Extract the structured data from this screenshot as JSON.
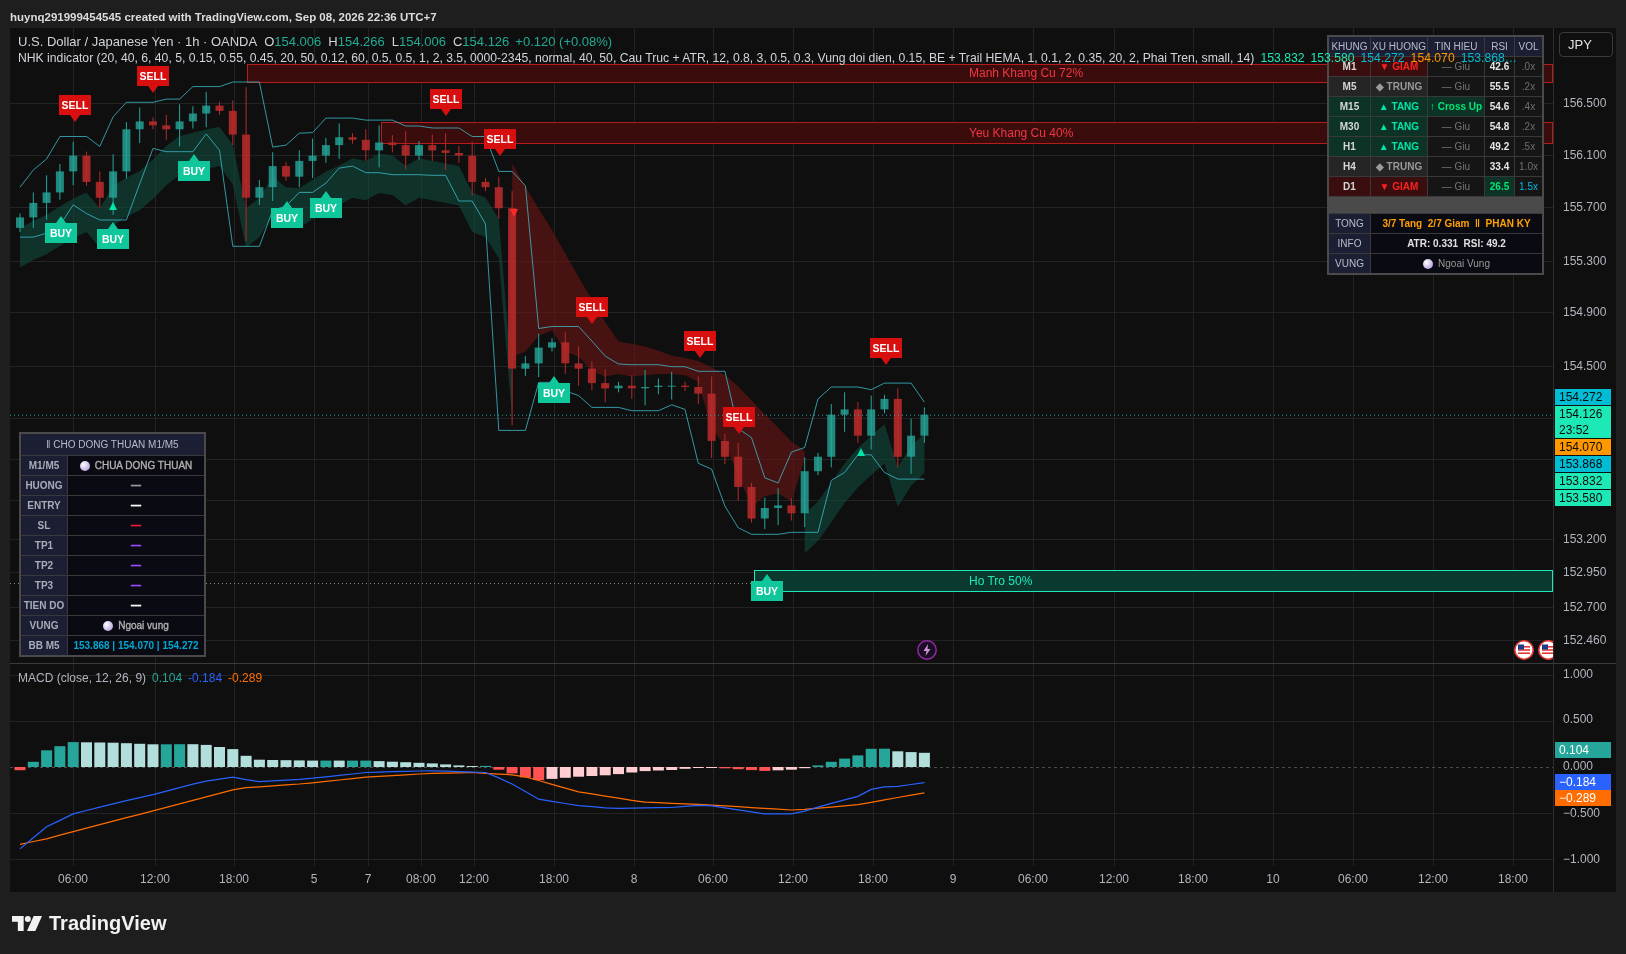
{
  "header": {
    "credit": "huynq291999454545 created with TradingView.com, Sep 08, 2026 22:36 UTC+7"
  },
  "legend": {
    "symbol": "U.S. Dollar / Japanese Yen · 1h · OANDA",
    "ohlc": [
      {
        "label": "O",
        "value": "154.006"
      },
      {
        "label": "H",
        "value": "154.266"
      },
      {
        "label": "L",
        "value": "154.006"
      },
      {
        "label": "C",
        "value": "154.126"
      }
    ],
    "change": "+0.120 (+0.08%)"
  },
  "indicator": {
    "title": "NHK indicator (20, 40, 6, 40, 5, 0.15, 0.55, 0.45, 20, 50, 0.12, 60, 0.5, 0.5, 1, 2, 3.5, 0000-2345, normal, 40, 50, Cau Truc + ATR, 12, 0.8, 3, 0.5, 0.3, Vung doi dien, 0.15, BE + Trail HEMA, 1, 0.1, 2, 0.35, 20, 2, Phai Tren, small, 14)",
    "values": [
      {
        "text": "153.832",
        "color": "#1de9b6"
      },
      {
        "text": "153.580",
        "color": "#1de9b6"
      },
      {
        "text": "154.272",
        "color": "#00bcd4"
      },
      {
        "text": "154.070",
        "color": "#ff9800"
      },
      {
        "text": "153.868…",
        "color": "#00bcd4"
      }
    ]
  },
  "timeframe_table": {
    "columns": [
      "KHUNG",
      "XU HUONG",
      "TIN HIEU",
      "RSI",
      "VOL"
    ],
    "rows": [
      {
        "timeframe": "M1",
        "kind": "down",
        "direction": "▼ GIAM",
        "signal": "— Giu",
        "crossover": false,
        "rsi": "42.6",
        "rsi_highlight": false,
        "vol": ".0x",
        "vol_highlight": false
      },
      {
        "timeframe": "M5",
        "kind": "neutral",
        "direction": "◆ TRUNG",
        "signal": "— Giu",
        "crossover": false,
        "rsi": "55.5",
        "rsi_highlight": false,
        "vol": ".2x",
        "vol_highlight": false
      },
      {
        "timeframe": "M15",
        "kind": "up",
        "direction": "▲ TANG",
        "signal": "↑ Cross Up",
        "crossover": true,
        "rsi": "54.6",
        "rsi_highlight": false,
        "vol": ".4x",
        "vol_highlight": false
      },
      {
        "timeframe": "M30",
        "kind": "up",
        "direction": "▲ TANG",
        "signal": "— Giu",
        "crossover": false,
        "rsi": "54.8",
        "rsi_highlight": false,
        "vol": ".2x",
        "vol_highlight": false
      },
      {
        "timeframe": "H1",
        "kind": "up",
        "direction": "▲ TANG",
        "signal": "— Giu",
        "crossover": false,
        "rsi": "49.2",
        "rsi_highlight": false,
        "vol": ".5x",
        "vol_highlight": false
      },
      {
        "timeframe": "H4",
        "kind": "neutral",
        "direction": "◆ TRUNG",
        "signal": "— Giu",
        "crossover": false,
        "rsi": "33.4",
        "rsi_highlight": false,
        "vol": "1.0x",
        "vol_highlight": false
      },
      {
        "timeframe": "D1",
        "kind": "down",
        "direction": "▼ GIAM",
        "signal": "— Giu",
        "crossover": false,
        "rsi": "26.5",
        "rsi_highlight": true,
        "vol": "1.5x",
        "vol_highlight": true
      }
    ],
    "summary": [
      {
        "label": "TONG",
        "kind": "summary",
        "text": "3/7 Tang  2/7 Giam  ‖  PHAN KY"
      },
      {
        "label": "INFO",
        "kind": "info",
        "text": "ATR: 0.331  RSI: 49.2"
      },
      {
        "label": "VUNG",
        "kind": "zone",
        "text": "Ngoai Vung"
      }
    ]
  },
  "currency_button": {
    "label": "JPY"
  },
  "zones": [
    {
      "kind": "resistance",
      "label": "Manh Khang Cu 72%"
    },
    {
      "kind": "resistance",
      "label": "Yeu Khang Cu 40%"
    },
    {
      "kind": "support",
      "label": "Ho Tro 50%"
    }
  ],
  "signals": [
    {
      "kind": "buy",
      "label": "BUY"
    },
    {
      "kind": "sell",
      "label": "SELL"
    },
    {
      "kind": "buy",
      "label": "BUY"
    },
    {
      "kind": "sell",
      "label": "SELL"
    },
    {
      "kind": "buy",
      "label": "BUY"
    },
    {
      "kind": "buy",
      "label": "BUY"
    },
    {
      "kind": "buy",
      "label": "BUY"
    },
    {
      "kind": "sell",
      "label": "SELL"
    },
    {
      "kind": "sell",
      "label": "SELL"
    },
    {
      "kind": "buy",
      "label": "BUY"
    },
    {
      "kind": "sell",
      "label": "SELL"
    },
    {
      "kind": "sell",
      "label": "SELL"
    },
    {
      "kind": "sell",
      "label": "SELL"
    },
    {
      "kind": "buy",
      "label": "BUY"
    },
    {
      "kind": "sell",
      "label": "SELL"
    }
  ],
  "consensus_panel": {
    "title": "‖ CHO DONG THUAN M1/M5",
    "rows": [
      {
        "label": "M1/M5",
        "kind": "status",
        "value": "CHUA DONG THUAN",
        "color": "#b0b0b0"
      },
      {
        "label": "HUONG",
        "kind": "value",
        "value": "—",
        "color": "#9e9e9e"
      },
      {
        "label": "ENTRY",
        "kind": "value",
        "value": "—",
        "color": "#ffffff"
      },
      {
        "label": "SL",
        "kind": "value",
        "value": "—",
        "color": "#ff1744"
      },
      {
        "label": "TP1",
        "kind": "value",
        "value": "—",
        "color": "#a64dff"
      },
      {
        "label": "TP2",
        "kind": "value",
        "value": "—",
        "color": "#a64dff"
      },
      {
        "label": "TP3",
        "kind": "value",
        "value": "—",
        "color": "#a64dff"
      },
      {
        "label": "TIEN DO",
        "kind": "value",
        "value": "—",
        "color": "#ffffff"
      },
      {
        "label": "VUNG",
        "kind": "status",
        "value": "Ngoai vung",
        "color": "#b0b0b0"
      },
      {
        "label": "BB M5",
        "kind": "bands",
        "value": "153.868 | 154.070 | 154.272"
      }
    ]
  },
  "price_axis": {
    "labels": [
      "156.500",
      "156.100",
      "155.700",
      "155.300",
      "154.900",
      "154.500",
      "153.200",
      "152.950",
      "152.700",
      "152.460"
    ],
    "tags": [
      {
        "text": "154.272",
        "color": "#00bcd4"
      },
      {
        "text": "154.126",
        "countdown": "23:52",
        "color": "#1de9b6"
      },
      {
        "text": "154.070",
        "color": "#ff9800"
      },
      {
        "text": "153.868",
        "color": "#00bcd4"
      },
      {
        "text": "153.832",
        "color": "#1de9b6"
      },
      {
        "text": "153.580",
        "color": "#1de9b6"
      }
    ]
  },
  "macd": {
    "title": "MACD (close, 12, 26, 9)",
    "values": [
      {
        "text": "0.104",
        "color": "#26a69a"
      },
      {
        "text": "-0.184",
        "color": "#2962ff"
      },
      {
        "text": "-0.289",
        "color": "#ff6d00"
      }
    ],
    "axis_labels": [
      "1.000",
      "0.500",
      "0.000",
      "−0.500",
      "−1.000"
    ],
    "tags": [
      {
        "text": "0.104",
        "color": "#26a69a"
      },
      {
        "text": "−0.184",
        "color": "#2962ff"
      },
      {
        "text": "−0.289",
        "color": "#ff6d00"
      }
    ]
  },
  "time_axis": {
    "labels": [
      "06:00",
      "12:00",
      "18:00",
      "5",
      "7",
      "08:00",
      "12:00",
      "18:00",
      "8",
      "06:00",
      "12:00",
      "18:00",
      "9",
      "06:00",
      "12:00",
      "18:00",
      "10",
      "06:00",
      "12:00",
      "18:00"
    ]
  },
  "footer": {
    "logo_text": "TradingView"
  }
}
